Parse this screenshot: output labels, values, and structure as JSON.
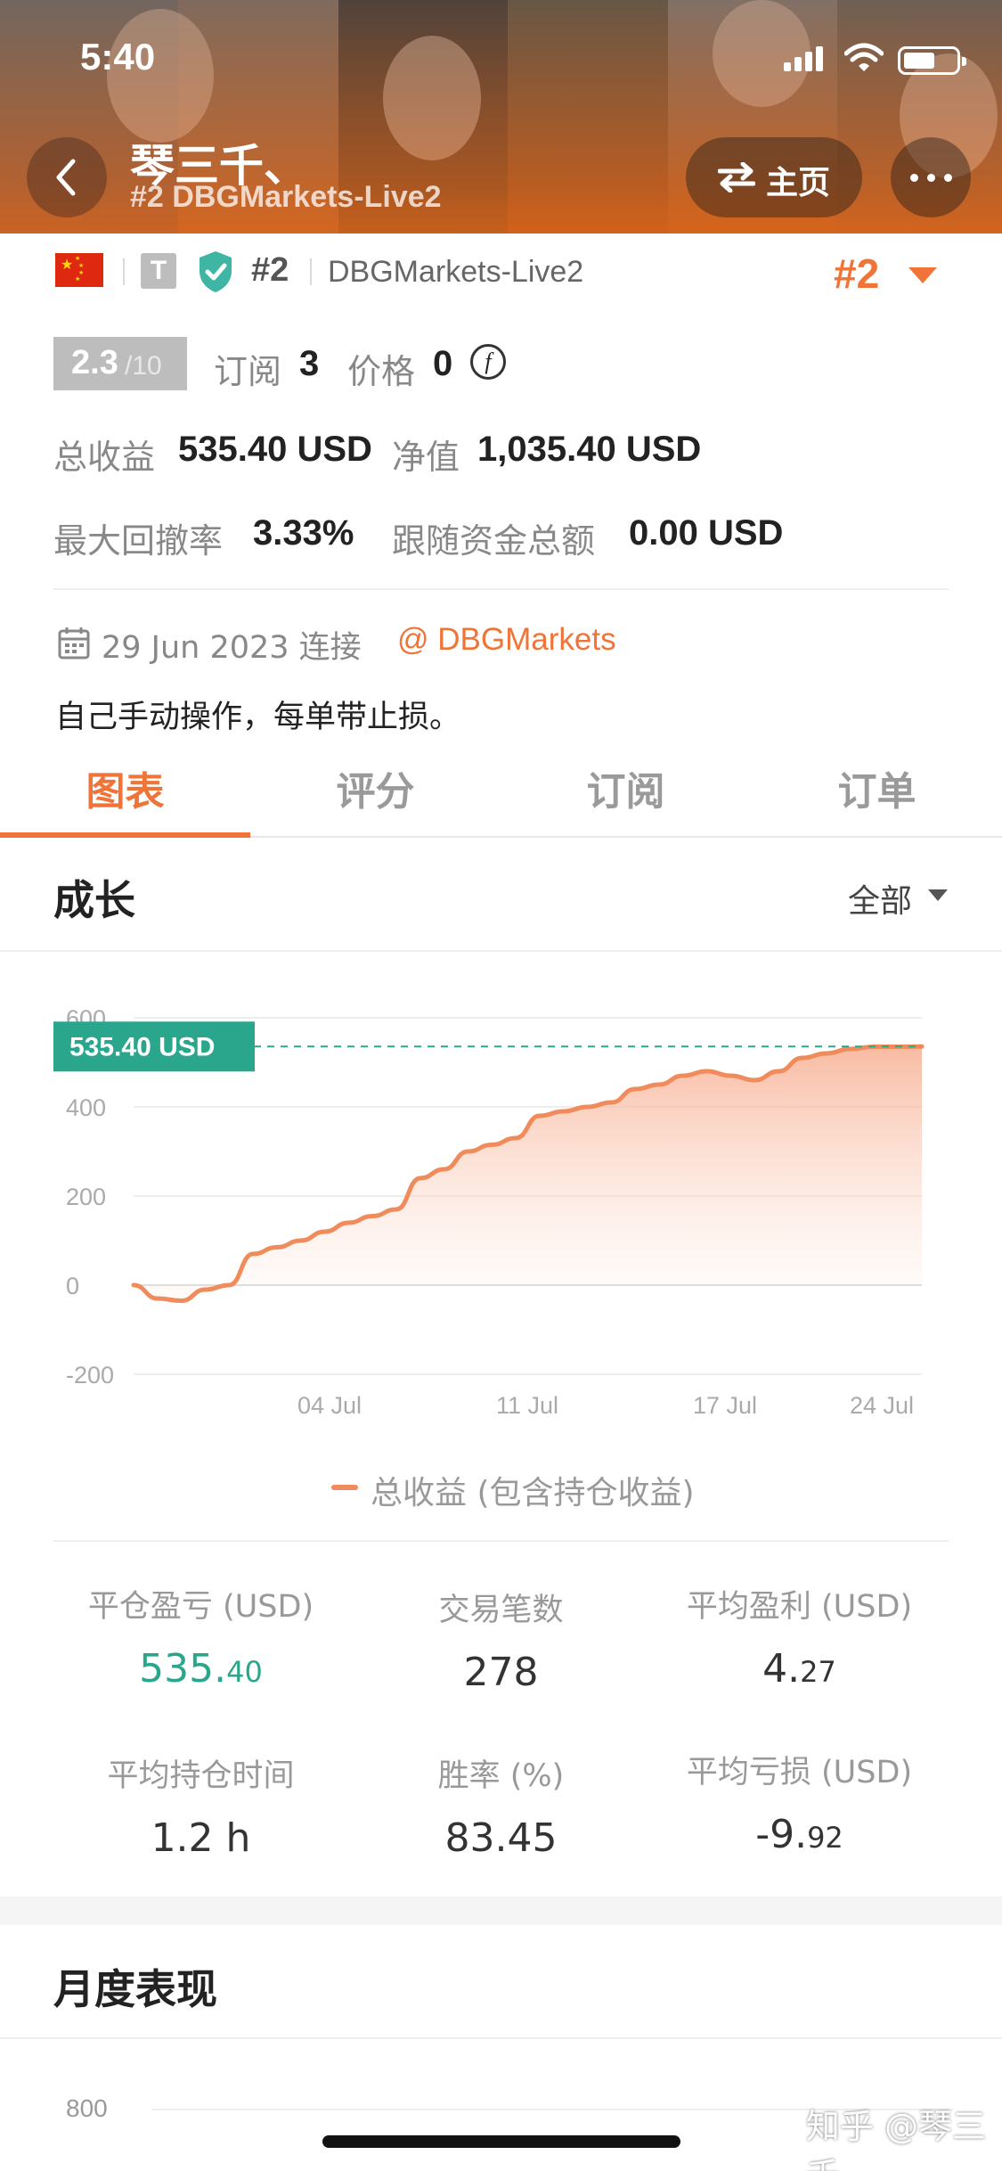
{
  "status_bar": {
    "time": "5:40"
  },
  "header": {
    "name": "琴三千、",
    "server": "#2 DBGMarkets-Live2",
    "home_label": "主页"
  },
  "profile": {
    "rank_small": "#2",
    "server_name": "DBGMarkets-Live2",
    "rank_big": "#2",
    "score": "2.3",
    "score_max": "/10",
    "subscribe_label": "订阅",
    "subscribe_count": "3",
    "price_label": "价格",
    "price_value": "0",
    "total_profit_label": "总收益",
    "total_profit_value": "535.40 USD",
    "equity_label": "净值",
    "equity_value": "1,035.40 USD",
    "max_drawdown_label": "最大回撤率",
    "max_drawdown_value": "3.33%",
    "follow_funds_label": "跟随资金总额",
    "follow_funds_value": "0.00 USD",
    "connect_date": "29 Jun 2023 连接",
    "broker": "@ DBGMarkets",
    "description": "自己手动操作，每单带止损。"
  },
  "tabs": [
    {
      "label": "图表",
      "active": true
    },
    {
      "label": "评分",
      "active": false
    },
    {
      "label": "订阅",
      "active": false
    },
    {
      "label": "订单",
      "active": false
    }
  ],
  "growth": {
    "title": "成长",
    "filter": "全部"
  },
  "chart_data": {
    "type": "area",
    "title": "",
    "current_value_label": "535.40 USD",
    "y_ticks": [
      "600",
      "400",
      "200",
      "0",
      "-200"
    ],
    "x_ticks": [
      "04 Jul",
      "11 Jul",
      "17 Jul",
      "24 Jul"
    ],
    "ylim": [
      -200,
      600
    ],
    "series": [
      {
        "name": "总收益 (包含持仓收益)",
        "color": "#f08c5c",
        "values": [
          0,
          -30,
          -35,
          -10,
          0,
          70,
          85,
          100,
          120,
          140,
          155,
          170,
          240,
          260,
          300,
          315,
          330,
          380,
          390,
          400,
          410,
          440,
          450,
          470,
          480,
          470,
          460,
          480,
          510,
          520,
          530,
          535,
          535,
          535.4
        ]
      }
    ],
    "grid": true,
    "legend": "bottom"
  },
  "stats": [
    {
      "label": "平仓盈亏 (USD)",
      "int": "535.",
      "dec": "40",
      "green": true
    },
    {
      "label": "交易笔数",
      "int": "278",
      "dec": "",
      "green": false
    },
    {
      "label": "平均盈利 (USD)",
      "int": "4.",
      "dec": "27",
      "green": false
    },
    {
      "label": "平均持仓时间",
      "int": "1.2 h",
      "dec": "",
      "green": false
    },
    {
      "label": "胜率 (%)",
      "int": "83.45",
      "dec": "",
      "green": false
    },
    {
      "label": "平均亏损 (USD)",
      "int": "-9.",
      "dec": "92",
      "green": false
    }
  ],
  "monthly": {
    "title": "月度表现",
    "first_tick": "800"
  },
  "watermark": "知乎 @琴三千、"
}
